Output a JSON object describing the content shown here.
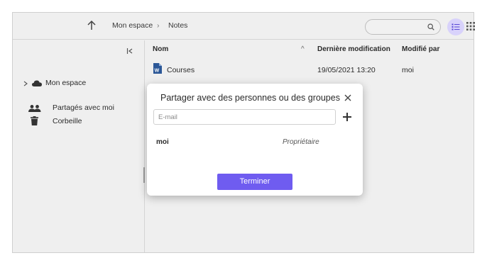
{
  "breadcrumb": {
    "root": "Mon espace",
    "separator": "›",
    "current": "Notes"
  },
  "search": {
    "placeholder": ""
  },
  "sidebar": {
    "items": [
      {
        "label": "Mon espace",
        "icon": "cloud-icon",
        "expand_icon": "chevron-right-icon"
      },
      {
        "label": "Partagés avec moi",
        "icon": "people-icon"
      },
      {
        "label": "Corbeille",
        "icon": "trash-icon"
      }
    ]
  },
  "table": {
    "columns": [
      "Nom",
      "Dernière modification",
      "Modifié par"
    ],
    "sort_indicator": "^",
    "rows": [
      {
        "name": "Courses",
        "modified": "19/05/2021 13:20",
        "modified_by": "moi",
        "icon": "word-document-icon"
      }
    ]
  },
  "modal": {
    "title": "Partager avec des personnes ou des groupes",
    "email_placeholder": "E-mail",
    "members": [
      {
        "name": "moi",
        "role": "Propriétaire"
      }
    ],
    "done_label": "Terminer"
  },
  "colors": {
    "accent": "#6f5cf0",
    "accent_light": "#d8d2fb",
    "background": "#efefef",
    "word_blue": "#2b5797"
  }
}
